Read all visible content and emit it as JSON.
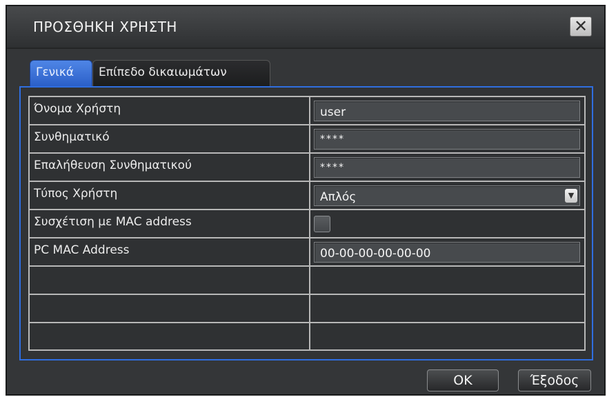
{
  "dialog": {
    "title": "ΠΡΟΣΘΗΚΗ ΧΡΗΣΤΗ",
    "close_glyph": "✕"
  },
  "tabs": [
    {
      "label": "Γενικά",
      "active": true
    },
    {
      "label": "Επίπεδο δικαιωμάτων",
      "active": false
    }
  ],
  "form": {
    "rows": [
      {
        "label": "Όνομα Χρήστη",
        "type": "text",
        "value": "user"
      },
      {
        "label": "Συνθηματικό",
        "type": "password",
        "value": "****"
      },
      {
        "label": "Επαλήθευση Συνθηματικού",
        "type": "password",
        "value": "****"
      },
      {
        "label": "Τύπος Χρήστη",
        "type": "select",
        "value": "Απλός"
      },
      {
        "label": "Συσχέτιση με MAC address",
        "type": "checkbox",
        "checked": false
      },
      {
        "label": "PC MAC Address",
        "type": "text",
        "value": "00-00-00-00-00-00"
      }
    ],
    "dropdown_icon": "chevron-down-icon"
  },
  "buttons": {
    "ok": "OK",
    "exit": "Έξοδος"
  },
  "colors": {
    "background": "#343638",
    "tab_active": "#3a6fd8",
    "content_border": "#2f6ee0",
    "grid_lines": "#b8b8b8"
  }
}
